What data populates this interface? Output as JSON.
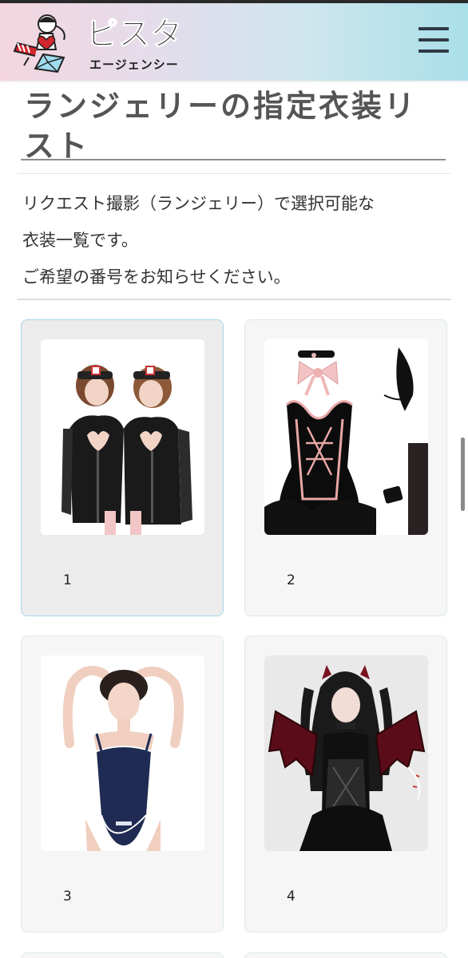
{
  "header": {
    "logo_main": "ピスタ",
    "logo_sub": "エージェンシー",
    "menu_icon": "hamburger-menu-icon"
  },
  "page": {
    "title": "ランジェリーの指定衣装リスト",
    "description_lines": [
      "リクエスト撮影（ランジェリー）で選択可能な",
      "衣装一覧です。",
      "ご希望の番号をお知らせください。"
    ]
  },
  "costumes": [
    {
      "number": "1",
      "active": true
    },
    {
      "number": "2",
      "active": false
    },
    {
      "number": "3",
      "active": false
    },
    {
      "number": "4",
      "active": false
    }
  ],
  "colors": {
    "header_gradient_start": "#f4d6df",
    "header_gradient_end": "#a9dfe9",
    "card_border": "#dbe9f0",
    "card_active_border": "#a7d6e8"
  }
}
